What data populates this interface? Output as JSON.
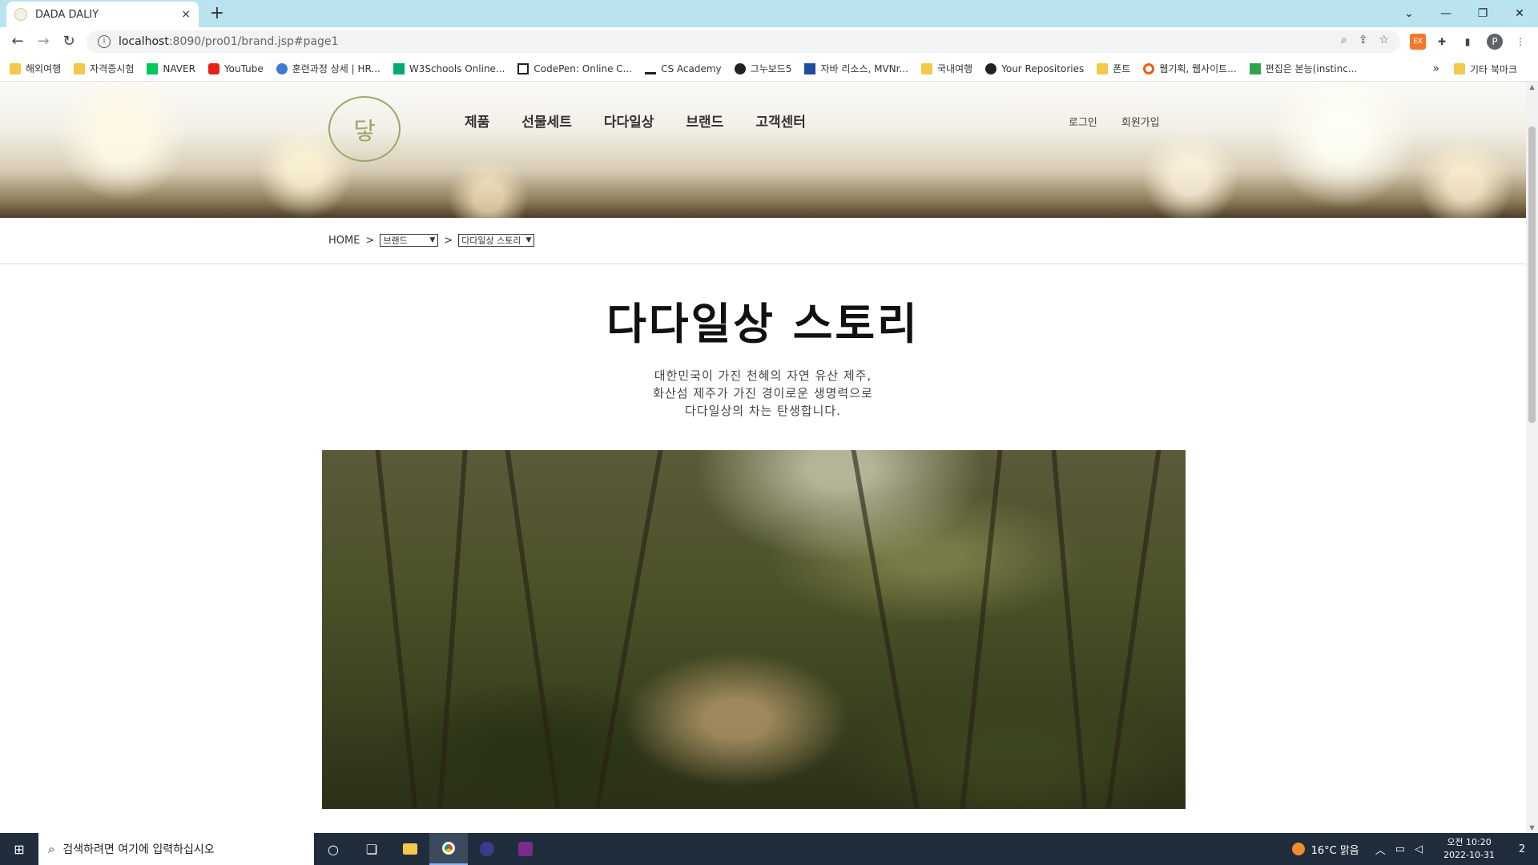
{
  "browser": {
    "tab_title": "DADA DALIY",
    "tab_close": "×",
    "new_tab": "+",
    "url_host": "localhost",
    "url_path": ":8090/pro01/brand.jsp#page1",
    "window_controls": [
      "⌄",
      "—",
      "❐",
      "✕"
    ],
    "bookmarks": [
      {
        "label": "해외여행",
        "icon": "folder"
      },
      {
        "label": "자격증시험",
        "icon": "folder"
      },
      {
        "label": "NAVER",
        "icon": "naver"
      },
      {
        "label": "YouTube",
        "icon": "youtube"
      },
      {
        "label": "훈련과정 상세 | HR...",
        "icon": "hrd"
      },
      {
        "label": "W3Schools Online...",
        "icon": "w3"
      },
      {
        "label": "CodePen: Online C...",
        "icon": "codepen"
      },
      {
        "label": "CS Academy",
        "icon": "csacademy"
      },
      {
        "label": "그누보드5",
        "icon": "gnuboard"
      },
      {
        "label": "자바 리소스, MVNr...",
        "icon": "mvn"
      },
      {
        "label": "국내여행",
        "icon": "folder"
      },
      {
        "label": "Your Repositories",
        "icon": "github"
      },
      {
        "label": "폰트",
        "icon": "folder"
      },
      {
        "label": "웹기획, 웹사이트...",
        "icon": "opera"
      },
      {
        "label": "편집은 본능(instinc...",
        "icon": "green"
      }
    ],
    "bookmarks_more": "»",
    "other_bookmarks": "기타 북마크"
  },
  "site": {
    "logo_text": "닿",
    "nav": [
      "제품",
      "선물세트",
      "다다일상",
      "브랜드",
      "고객센터"
    ],
    "login": "로그인",
    "signup": "회원가입",
    "breadcrumb": {
      "home": "HOME",
      "separator": ">",
      "select1": "브랜드",
      "select2": "다다일상 스토리"
    },
    "title": "다다일상 스토리",
    "intro_lines": [
      "대한민국이 가진 천혜의 자연 유산 제주,",
      "화산섬 제주가 가진 경이로운 생명력으로",
      "다다일상의 차는 탄생합니다."
    ]
  },
  "taskbar": {
    "search_placeholder": "검색하려면 여기에 입력하십시오",
    "weather": "16°C 맑음",
    "time": "오전 10:20",
    "date": "2022-10-31",
    "notification_count": "2"
  }
}
